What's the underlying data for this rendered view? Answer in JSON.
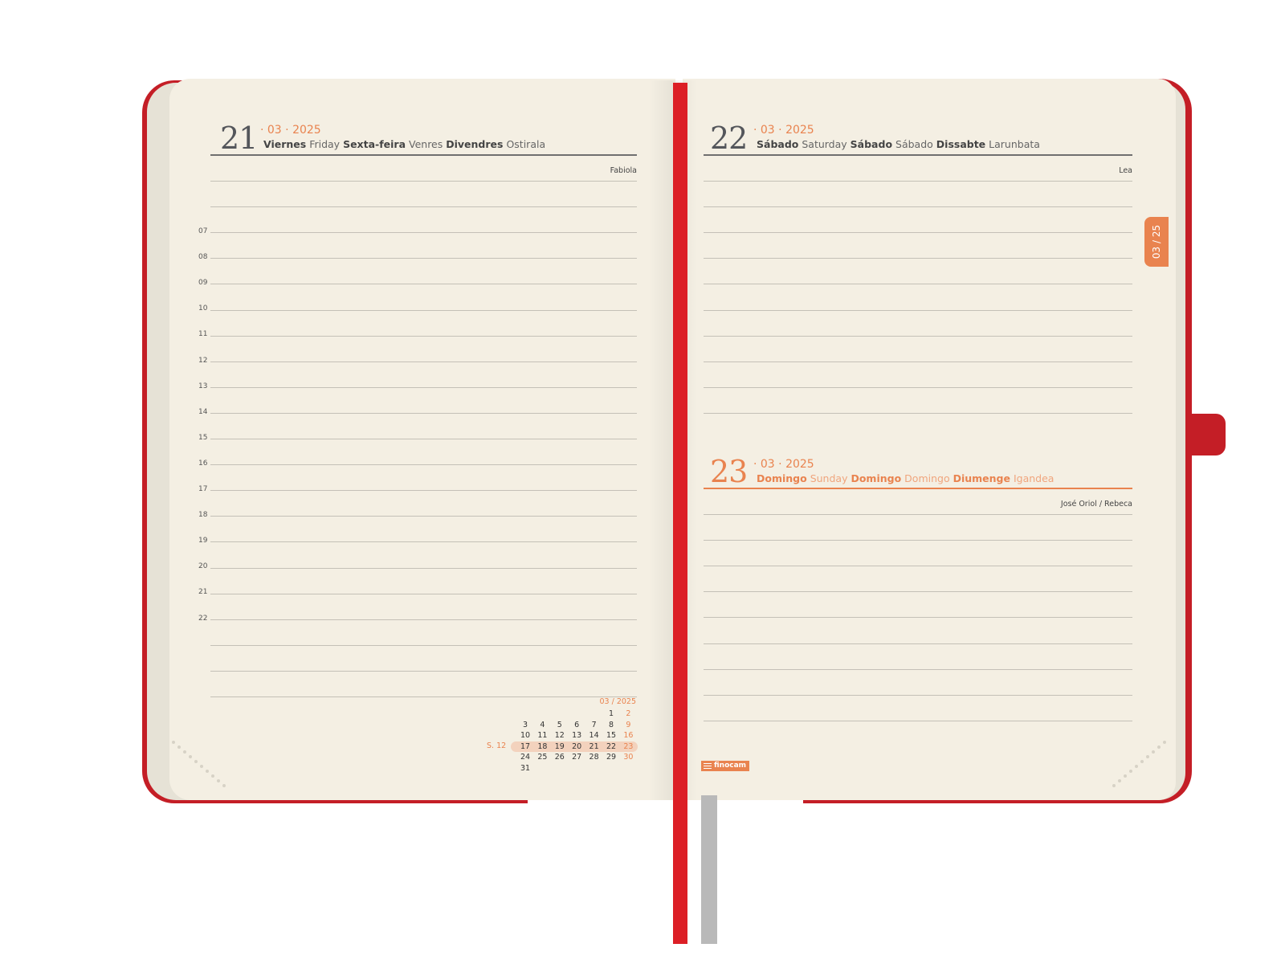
{
  "left_page": {
    "day": "21",
    "date": "· 03 · 2025",
    "names": [
      {
        "text": "Viernes",
        "bold": true
      },
      {
        "text": "Friday",
        "bold": false
      },
      {
        "text": "Sexta-feira",
        "bold": true
      },
      {
        "text": "Venres",
        "bold": false
      },
      {
        "text": "Divendres",
        "bold": true
      },
      {
        "text": "Ostirala",
        "bold": false
      }
    ],
    "saint": "Fabiola",
    "hours": [
      "07",
      "08",
      "09",
      "10",
      "11",
      "12",
      "13",
      "14",
      "15",
      "16",
      "17",
      "18",
      "19",
      "20",
      "21",
      "22"
    ]
  },
  "right_page": {
    "day1": {
      "day": "22",
      "date": "· 03 · 2025",
      "names": [
        {
          "text": "Sábado",
          "bold": true
        },
        {
          "text": "Saturday",
          "bold": false
        },
        {
          "text": "Sábado",
          "bold": true
        },
        {
          "text": "Sábado",
          "bold": false
        },
        {
          "text": "Dissabte",
          "bold": true
        },
        {
          "text": "Larunbata",
          "bold": false
        }
      ],
      "saint": "Lea"
    },
    "day2": {
      "day": "23",
      "date": "· 03 · 2025",
      "names": [
        {
          "text": "Domingo",
          "bold": true
        },
        {
          "text": "Sunday",
          "bold": false
        },
        {
          "text": "Domingo",
          "bold": true
        },
        {
          "text": "Domingo",
          "bold": false
        },
        {
          "text": "Diumenge",
          "bold": true
        },
        {
          "text": "Igandea",
          "bold": false
        }
      ],
      "saint": "José Oriol / Rebeca"
    },
    "month_tab": "03 / 25",
    "brand": "finocam"
  },
  "mini_calendar": {
    "title": "03 / 2025",
    "week_label": "S. 12",
    "rows": [
      [
        "",
        "",
        "",
        "",
        "",
        "1",
        "2"
      ],
      [
        "3",
        "4",
        "5",
        "6",
        "7",
        "8",
        "9"
      ],
      [
        "10",
        "11",
        "12",
        "13",
        "14",
        "15",
        "16"
      ],
      [
        "17",
        "18",
        "19",
        "20",
        "21",
        "22",
        "23"
      ],
      [
        "24",
        "25",
        "26",
        "27",
        "28",
        "29",
        "30"
      ],
      [
        "31",
        "",
        "",
        "",
        "",
        "",
        ""
      ]
    ],
    "highlight_row": 3
  },
  "colors": {
    "cover": "#c41e26",
    "paper": "#f4efe3",
    "accent": "#e9834f",
    "ribbon_red": "#dc1f26",
    "ribbon_grey": "#b9b9b9"
  }
}
